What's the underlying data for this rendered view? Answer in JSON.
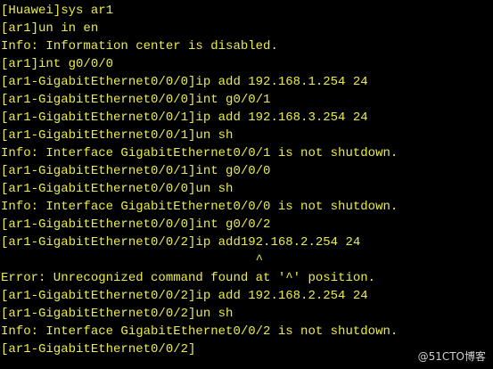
{
  "terminal": {
    "colors": {
      "background": "#000000",
      "text": "#ECEC4A"
    },
    "lines": [
      "[Huawei]sys ar1",
      "[ar1]un in en",
      "Info: Information center is disabled.",
      "[ar1]int g0/0/0",
      "[ar1-GigabitEthernet0/0/0]ip add 192.168.1.254 24",
      "[ar1-GigabitEthernet0/0/0]int g0/0/1",
      "[ar1-GigabitEthernet0/0/1]ip add 192.168.3.254 24",
      "[ar1-GigabitEthernet0/0/1]un sh",
      "Info: Interface GigabitEthernet0/0/1 is not shutdown.",
      "[ar1-GigabitEthernet0/0/1]int g0/0/0",
      "[ar1-GigabitEthernet0/0/0]un sh",
      "Info: Interface GigabitEthernet0/0/0 is not shutdown.",
      "[ar1-GigabitEthernet0/0/0]int g0/0/2",
      "[ar1-GigabitEthernet0/0/2]ip add192.168.2.254 24",
      "                                  ^",
      "Error: Unrecognized command found at '^' position.",
      "[ar1-GigabitEthernet0/0/2]ip add 192.168.2.254 24",
      "[ar1-GigabitEthernet0/0/2]un sh",
      "Info: Interface GigabitEthernet0/0/2 is not shutdown.",
      "[ar1-GigabitEthernet0/0/2]"
    ]
  },
  "watermark": {
    "text": "@51CTO博客"
  }
}
